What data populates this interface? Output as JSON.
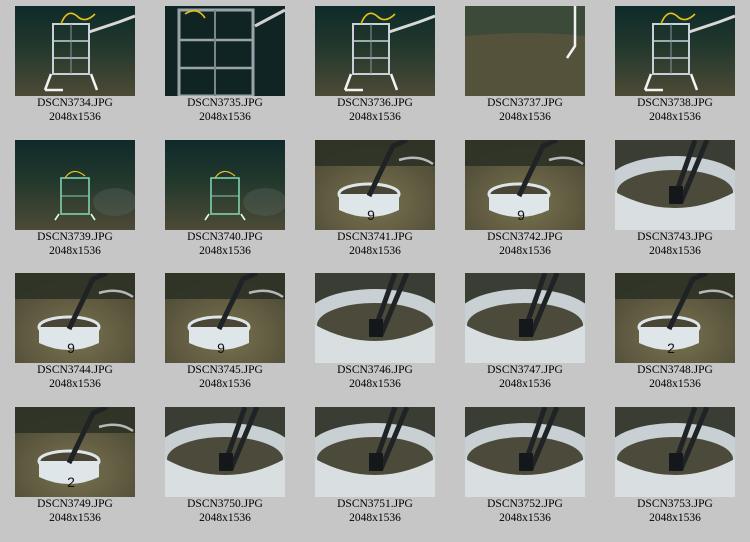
{
  "gallery": {
    "items": [
      {
        "filename": "DSCN3734.JPG",
        "dimensions": "2048x1536",
        "scene": "cage-wide"
      },
      {
        "filename": "DSCN3735.JPG",
        "dimensions": "2048x1536",
        "scene": "cage-close"
      },
      {
        "filename": "DSCN3736.JPG",
        "dimensions": "2048x1536",
        "scene": "cage-wide"
      },
      {
        "filename": "DSCN3737.JPG",
        "dimensions": "2048x1536",
        "scene": "seafloor"
      },
      {
        "filename": "DSCN3738.JPG",
        "dimensions": "2048x1536",
        "scene": "cage-wide"
      },
      {
        "filename": "DSCN3739.JPG",
        "dimensions": "2048x1536",
        "scene": "cage-far"
      },
      {
        "filename": "DSCN3740.JPG",
        "dimensions": "2048x1536",
        "scene": "cage-far"
      },
      {
        "filename": "DSCN3741.JPG",
        "dimensions": "2048x1536",
        "scene": "ring",
        "label": "9"
      },
      {
        "filename": "DSCN3742.JPG",
        "dimensions": "2048x1536",
        "scene": "ring",
        "label": "9"
      },
      {
        "filename": "DSCN3743.JPG",
        "dimensions": "2048x1536",
        "scene": "ring-close"
      },
      {
        "filename": "DSCN3744.JPG",
        "dimensions": "2048x1536",
        "scene": "ring",
        "label": "9"
      },
      {
        "filename": "DSCN3745.JPG",
        "dimensions": "2048x1536",
        "scene": "ring",
        "label": "9"
      },
      {
        "filename": "DSCN3746.JPG",
        "dimensions": "2048x1536",
        "scene": "ring-close"
      },
      {
        "filename": "DSCN3747.JPG",
        "dimensions": "2048x1536",
        "scene": "ring-close"
      },
      {
        "filename": "DSCN3748.JPG",
        "dimensions": "2048x1536",
        "scene": "ring",
        "label": "2"
      },
      {
        "filename": "DSCN3749.JPG",
        "dimensions": "2048x1536",
        "scene": "ring",
        "label": "2"
      },
      {
        "filename": "DSCN3750.JPG",
        "dimensions": "2048x1536",
        "scene": "ring-close"
      },
      {
        "filename": "DSCN3751.JPG",
        "dimensions": "2048x1536",
        "scene": "ring-close"
      },
      {
        "filename": "DSCN3752.JPG",
        "dimensions": "2048x1536",
        "scene": "ring-close"
      },
      {
        "filename": "DSCN3753.JPG",
        "dimensions": "2048x1536",
        "scene": "ring-close"
      }
    ]
  },
  "colors": {
    "page_background": "#c6c6c6",
    "seafloor": "#4d4a36",
    "water": "#0e2a2a",
    "cage_frame": "#c8d0d8",
    "cable": "#e6c21a",
    "ring": "#dfe6ea",
    "arm": "#202325"
  }
}
